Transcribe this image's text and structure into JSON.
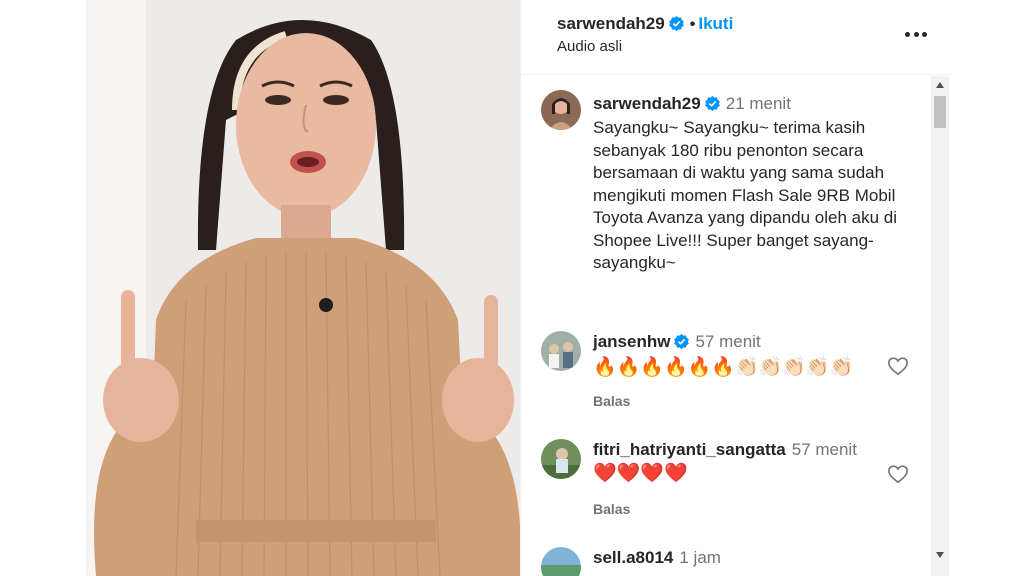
{
  "post": {
    "username": "sarwendah29",
    "separator": "•",
    "follow_label": "Ikuti",
    "audio_label": "Audio asli",
    "more_icon": "more-horizontal-icon",
    "verified_color": "#0095f6"
  },
  "caption": {
    "username": "sarwendah29",
    "time": "21 menit",
    "text": "Sayangku~ Sayangku~ terima kasih sebanyak 180 ribu penonton secara bersamaan di waktu yang sama sudah mengikuti momen Flash Sale 9RB Mobil Toyota Avanza yang dipandu oleh aku di Shopee Live!!! Super banget sayang-sayangku~"
  },
  "comments": [
    {
      "username": "jansenhw",
      "verified": true,
      "time": "57 menit",
      "text": "🔥🔥🔥🔥🔥🔥👏🏻👏🏻👏🏻👏🏻👏🏻",
      "reply_label": "Balas"
    },
    {
      "username": "fitri_hatriyanti_sangatta",
      "verified": false,
      "time": "57 menit",
      "text": "❤️❤️❤️❤️",
      "reply_label": "Balas"
    },
    {
      "username": "sell.a8014",
      "verified": false,
      "time": "1 jam",
      "text": "",
      "reply_label": ""
    }
  ]
}
